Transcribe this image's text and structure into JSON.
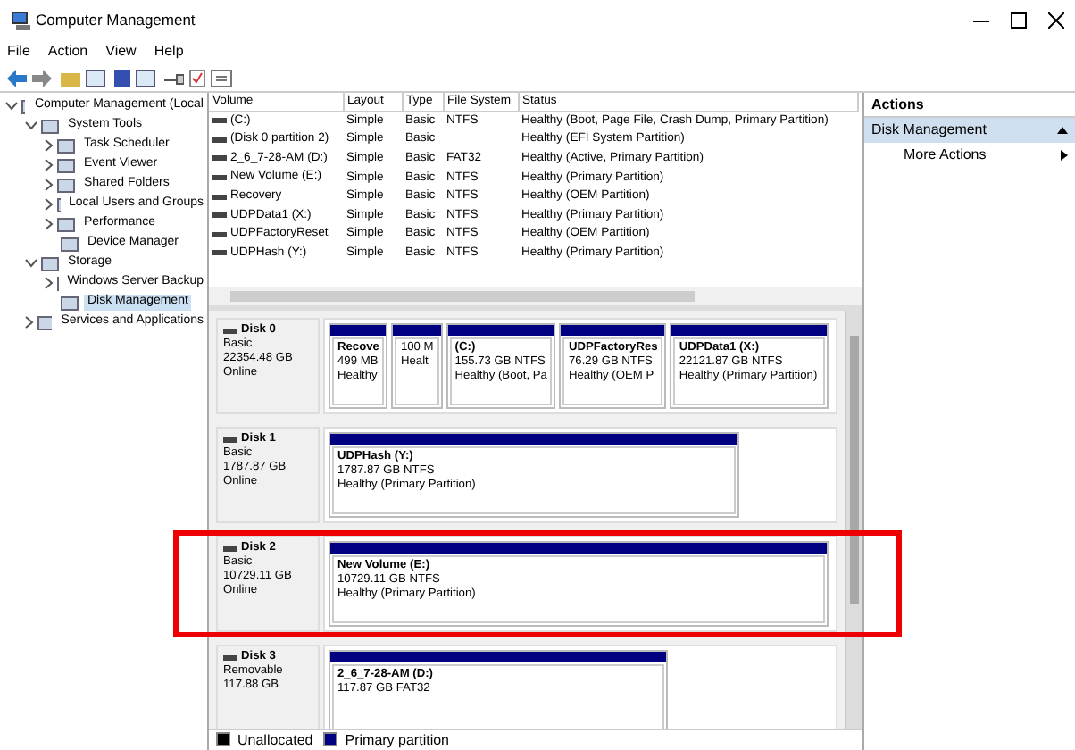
{
  "window": {
    "title": "Computer Management"
  },
  "menu": [
    "File",
    "Action",
    "View",
    "Help"
  ],
  "tree": [
    {
      "label": "Computer Management (Local",
      "expanded": true,
      "selected": false,
      "children": [
        {
          "label": "System Tools",
          "expanded": true,
          "selected": false,
          "children": [
            {
              "label": "Task Scheduler",
              "expanded": false,
              "selected": false
            },
            {
              "label": "Event Viewer",
              "expanded": false,
              "selected": false
            },
            {
              "label": "Shared Folders",
              "expanded": false,
              "selected": false
            },
            {
              "label": "Local Users and Groups",
              "expanded": false,
              "selected": false
            },
            {
              "label": "Performance",
              "expanded": false,
              "selected": false
            },
            {
              "label": "Device Manager",
              "selected": false
            }
          ]
        },
        {
          "label": "Storage",
          "expanded": true,
          "selected": false,
          "children": [
            {
              "label": "Windows Server Backup",
              "expanded": false,
              "selected": false
            },
            {
              "label": "Disk Management",
              "selected": true
            }
          ]
        },
        {
          "label": "Services and Applications",
          "expanded": false,
          "selected": false
        }
      ]
    }
  ],
  "volumes": {
    "columns": [
      "Volume",
      "Layout",
      "Type",
      "File System",
      "Status"
    ],
    "rows": [
      [
        "(C:)",
        "Simple",
        "Basic",
        "NTFS",
        "Healthy (Boot, Page File, Crash Dump, Primary Partition)"
      ],
      [
        "(Disk 0 partition 2)",
        "Simple",
        "Basic",
        null,
        "Healthy (EFI System Partition)"
      ],
      [
        "2_6_7-28-AM (D:)",
        "Simple",
        "Basic",
        "FAT32",
        "Healthy (Active, Primary Partition)"
      ],
      [
        "New Volume (E:)",
        "Simple",
        "Basic",
        "NTFS",
        "Healthy (Primary Partition)"
      ],
      [
        "Recovery",
        "Simple",
        "Basic",
        "NTFS",
        "Healthy (OEM Partition)"
      ],
      [
        "UDPData1 (X:)",
        "Simple",
        "Basic",
        "NTFS",
        "Healthy (Primary Partition)"
      ],
      [
        "UDPFactoryReset",
        "Simple",
        "Basic",
        "NTFS",
        "Healthy (OEM Partition)"
      ],
      [
        "UDPHash (Y:)",
        "Simple",
        "Basic",
        "NTFS",
        "Healthy (Primary Partition)"
      ]
    ]
  },
  "disks": [
    {
      "name": "Disk 0",
      "type": "Basic",
      "size": "22354.48 GB",
      "status": "Online",
      "highlighted": false,
      "partitions": [
        {
          "label": "Recove",
          "size": "499 MB",
          "status": "Healthy"
        },
        {
          "size": "100 M",
          "status": "Healt"
        },
        {
          "label": "(C:)",
          "size": "155.73 GB NTFS",
          "status": "Healthy (Boot, Pa"
        },
        {
          "label": "UDPFactoryRes",
          "size": "76.29 GB NTFS",
          "status": "Healthy (OEM P"
        },
        {
          "label": "UDPData1  (X:)",
          "size": "22121.87 GB NTFS",
          "status": "Healthy (Primary Partition)"
        }
      ]
    },
    {
      "name": "Disk 1",
      "type": "Basic",
      "size": "1787.87 GB",
      "status": "Online",
      "highlighted": false,
      "partitions": [
        {
          "label": "UDPHash  (Y:)",
          "size": "1787.87 GB NTFS",
          "status": "Healthy (Primary Partition)"
        }
      ]
    },
    {
      "name": "Disk 2",
      "type": "Basic",
      "size": "10729.11 GB",
      "status": "Online",
      "highlighted": true,
      "partitions": [
        {
          "label": "New Volume  (E:)",
          "size": "10729.11 GB NTFS",
          "status": "Healthy (Primary Partition)"
        }
      ]
    },
    {
      "name": "Disk 3",
      "type": "Removable",
      "size": "117.88 GB",
      "highlighted": false,
      "partitions": [
        {
          "label": "2_6_7-28-AM  (D:)",
          "size": "117.87 GB FAT32"
        }
      ]
    }
  ],
  "legend": [
    {
      "label": "Unallocated",
      "color": "#000000"
    },
    {
      "label": "Primary partition",
      "color": "#000080"
    }
  ],
  "actions": {
    "header": "Actions",
    "items": [
      {
        "label": "Disk Management",
        "kind": "section"
      },
      {
        "label": "More Actions",
        "kind": "item"
      }
    ]
  }
}
